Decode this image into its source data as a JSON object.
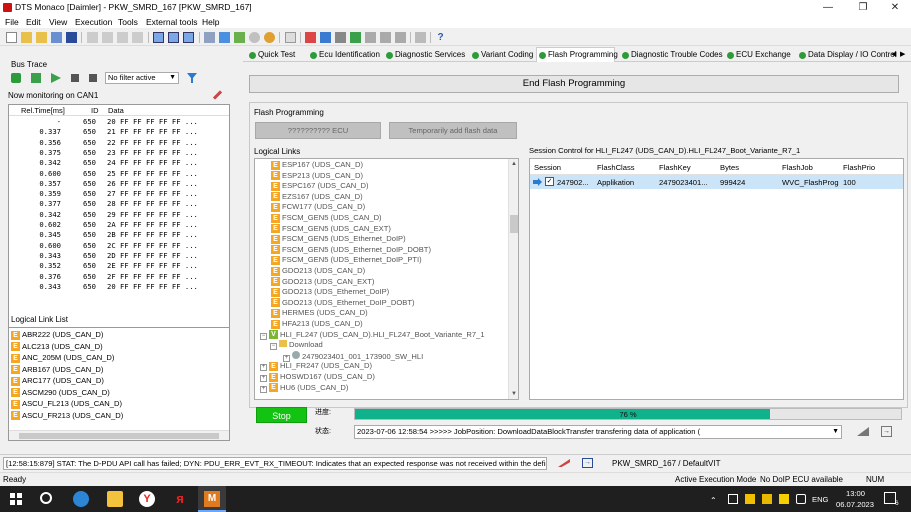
{
  "window": {
    "title": "DTS Monaco [Daimler] - PKW_SMRD_167 [PKW_SMRD_167]"
  },
  "menu": [
    "File",
    "Edit",
    "View",
    "Execution",
    "Tools",
    "External tools",
    "Help"
  ],
  "bus_trace": {
    "title": "Bus Trace",
    "filter": "No filter active",
    "monitoring": "Now monitoring on CAN1",
    "columns": {
      "time": "Rel.Time[ms]",
      "id": "ID",
      "data": "Data"
    },
    "rows": [
      {
        "time": "-",
        "id": "650",
        "data": "20 FF FF FF FF FF ..."
      },
      {
        "time": "0.337",
        "id": "650",
        "data": "21 FF FF FF FF FF ..."
      },
      {
        "time": "0.356",
        "id": "650",
        "data": "22 FF FF FF FF FF ..."
      },
      {
        "time": "0.375",
        "id": "650",
        "data": "23 FF FF FF FF FF ..."
      },
      {
        "time": "0.342",
        "id": "650",
        "data": "24 FF FF FF FF FF ..."
      },
      {
        "time": "0.600",
        "id": "650",
        "data": "25 FF FF FF FF FF ..."
      },
      {
        "time": "0.357",
        "id": "650",
        "data": "26 FF FF FF FF FF ..."
      },
      {
        "time": "0.359",
        "id": "650",
        "data": "27 FF FF FF FF FF ..."
      },
      {
        "time": "0.377",
        "id": "650",
        "data": "28 FF FF FF FF FF ..."
      },
      {
        "time": "0.342",
        "id": "650",
        "data": "29 FF FF FF FF FF ..."
      },
      {
        "time": "0.602",
        "id": "650",
        "data": "2A FF FF FF FF FF ..."
      },
      {
        "time": "0.345",
        "id": "650",
        "data": "2B FF FF FF FF FF ..."
      },
      {
        "time": "0.600",
        "id": "650",
        "data": "2C FF FF FF FF FF ..."
      },
      {
        "time": "0.343",
        "id": "650",
        "data": "2D FF FF FF FF FF ..."
      },
      {
        "time": "0.352",
        "id": "650",
        "data": "2E FF FF FF FF FF ..."
      },
      {
        "time": "0.376",
        "id": "650",
        "data": "2F FF FF FF FF FF ..."
      },
      {
        "time": "0.343",
        "id": "650",
        "data": "20 FF FF FF FF FF ..."
      }
    ]
  },
  "logical_link_list": {
    "title": "Logical Link List",
    "items": [
      "ABR222 (UDS_CAN_D)",
      "ALC213 (UDS_CAN_D)",
      "ANC_205M (UDS_CAN_D)",
      "ARB167 (UDS_CAN_D)",
      "ARC177 (UDS_CAN_D)",
      "ASCM290 (UDS_CAN_D)",
      "ASCU_FL213 (UDS_CAN_D)",
      "ASCU_FR213 (UDS_CAN_D)"
    ]
  },
  "tabs": [
    "Quick Test",
    "Ecu Identification",
    "Diagnostic Services",
    "Variant Coding",
    "Flash Programming",
    "Diagnostic Trouble Codes",
    "ECU Exchange",
    "Data Display / IO Control"
  ],
  "active_tab": "Flash Programming",
  "flash": {
    "end_button": "End Flash Programming",
    "group_title": "Flash Programming",
    "ecu_button": "?????????? ECU",
    "add_flash_button": "Temporarily add flash data",
    "logical_links_title": "Logical Links",
    "tree_items": [
      "ESP167 (UDS_CAN_D)",
      "ESP213 (UDS_CAN_D)",
      "ESPC167 (UDS_CAN_D)",
      "EZS167 (UDS_CAN_D)",
      "FCW177 (UDS_CAN_D)",
      "FSCM_GEN5 (UDS_CAN_D)",
      "FSCM_GEN5 (UDS_CAN_EXT)",
      "FSCM_GEN5 (UDS_Ethernet_DoIP)",
      "FSCM_GEN5 (UDS_Ethernet_DoIP_DOBT)",
      "FSCM_GEN5 (UDS_Ethernet_DoIP_PTI)",
      "GDO213 (UDS_CAN_D)",
      "GDO213 (UDS_CAN_EXT)",
      "GDO213 (UDS_Ethernet_DoIP)",
      "GDO213 (UDS_Ethernet_DoIP_DOBT)",
      "HERMES (UDS_CAN_D)",
      "HFA213 (UDS_CAN_D)"
    ],
    "selected_link": "HLI_FL247 (UDS_CAN_D).HLI_FL247_Boot_Variante_R7_1",
    "download_label": "Download",
    "download_file": "2479023401_001_173900_SW_HLI",
    "tree_items_after": [
      "HLI_FR247 (UDS_CAN_D)",
      "HOSWD167 (UDS_CAN_D)",
      "HU6 (UDS_CAN_D)"
    ],
    "session_title": "Session Control for HLI_FL247 (UDS_CAN_D).HLI_FL247_Boot_Variante_R7_1",
    "session_columns": [
      "Session",
      "FlashClass",
      "FlashKey",
      "Bytes",
      "FlashJob",
      "FlashPrio"
    ],
    "session_row": {
      "session": "247902...",
      "flashclass": "Applikation",
      "flashkey": "2479023401...",
      "bytes": "999424",
      "flashjob": "WVC_FlashProg",
      "flashprio": "100"
    },
    "stop_button": "Stop",
    "progress_label": "进度:",
    "progress_percent": 76,
    "progress_text": "76 %",
    "status_label": "状态:",
    "status_text": "2023-07-06 12:58:54  >>>>> JobPosition: DownloadDataBlockTransfer transfering data of application ("
  },
  "message_bar": {
    "text": "[12:58:15:879] STAT: The D-PDU API call has failed; DYN: PDU_ERR_EVT_RX_TIMEOUT: Indicates that an expected response was not received within the defined t",
    "vehicle": "PKW_SMRD_167 / DefaultVIT"
  },
  "status_bar": {
    "left": "Ready",
    "mode": "Active Execution Mode",
    "doip": "No DoIP ECU available",
    "num": "NUM"
  },
  "taskbar": {
    "lang": "ENG",
    "time": "13:00",
    "date": "06.07.2023",
    "notif": "6"
  },
  "colors": {
    "ok_green": "#2e9b3a",
    "stop_green": "#12c312",
    "progress": "#0fb28b",
    "ecu_badge": "#f5a623"
  }
}
